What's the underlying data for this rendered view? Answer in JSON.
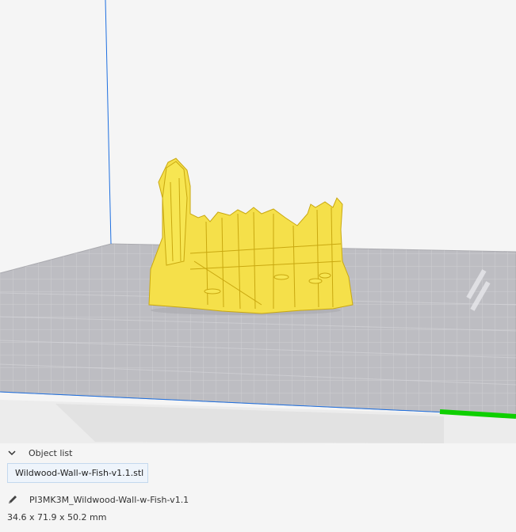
{
  "object_list": {
    "header": "Object list",
    "items": [
      "Wildwood-Wall-w-Fish-v1.1.stl"
    ]
  },
  "job": {
    "name": "PI3MK3M_Wildwood-Wall-w-Fish-v1.1",
    "dimensions": "34.6 x 71.9 x 50.2 mm"
  },
  "colors": {
    "model": "#f5e04a",
    "build_plate": "#bcbcc2",
    "grid_line": "#d8d8dc",
    "axis_blue": "#1e6fe0",
    "axis_green": "#0ecf00",
    "selection_bg": "#eef4fb"
  },
  "icons": [
    "chevron-down-icon",
    "pencil-icon"
  ]
}
